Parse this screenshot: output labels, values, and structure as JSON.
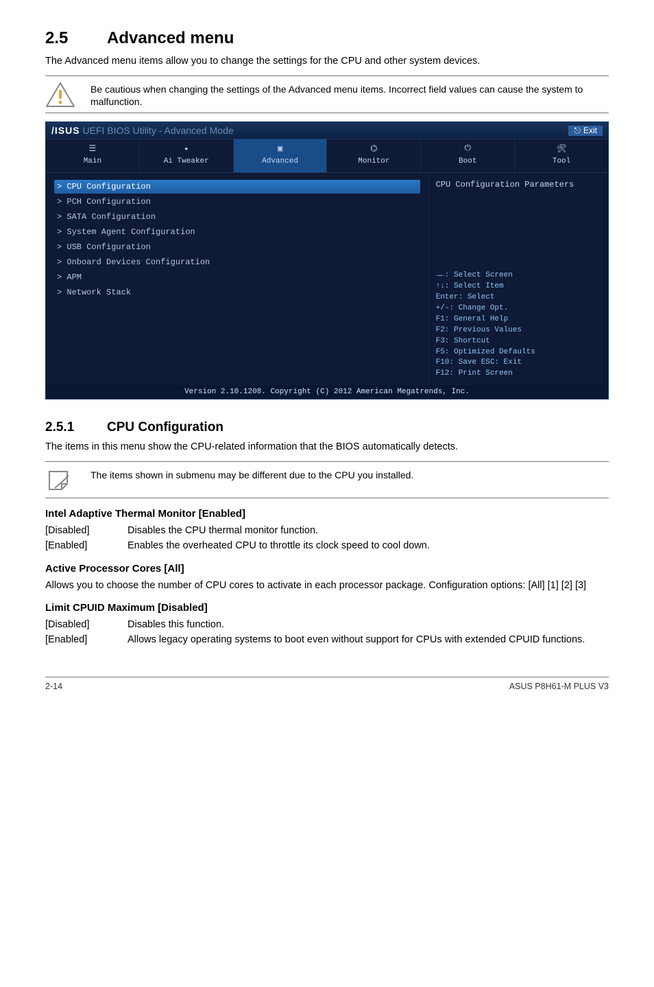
{
  "section": {
    "number": "2.5",
    "title": "Advanced menu",
    "intro": "The Advanced menu items allow you to change the settings for the CPU and other system devices."
  },
  "warning": "Be cautious when changing the settings of the Advanced menu items. Incorrect field values can cause the system to malfunction.",
  "bios": {
    "brand": "/ISUS",
    "title": "UEFI BIOS Utility - Advanced Mode",
    "exit": "Exit",
    "tabs": [
      {
        "label": "Main"
      },
      {
        "label": "Ai Tweaker"
      },
      {
        "label": "Advanced"
      },
      {
        "label": "Monitor"
      },
      {
        "label": "Boot"
      },
      {
        "label": "Tool"
      }
    ],
    "menu": [
      {
        "label": "CPU Configuration",
        "highlight": true,
        "marker": ">"
      },
      {
        "label": "PCH Configuration",
        "marker": ">"
      },
      {
        "label": "SATA Configuration",
        "marker": ">"
      },
      {
        "label": "System Agent Configuration",
        "marker": ">"
      },
      {
        "label": "USB Configuration",
        "marker": ">"
      },
      {
        "label": "Onboard Devices Configuration",
        "marker": ">"
      },
      {
        "label": "APM",
        "marker": ">"
      },
      {
        "label": "Network Stack",
        "marker": ">"
      }
    ],
    "help_title": "CPU Configuration Parameters",
    "help_keys": [
      "→←: Select Screen",
      "↑↓: Select Item",
      "Enter: Select",
      "+/-: Change Opt.",
      "F1: General Help",
      "F2: Previous Values",
      "F3: Shortcut",
      "F5: Optimized Defaults",
      "F10: Save  ESC: Exit",
      "F12: Print Screen"
    ],
    "footer": "Version 2.10.1208. Copyright (C) 2012 American Megatrends, Inc."
  },
  "subsection": {
    "number": "2.5.1",
    "title": "CPU Configuration",
    "intro": "The items in this menu show the CPU-related information that the BIOS automatically detects.",
    "note": "The items shown in submenu may be different due to the CPU you installed."
  },
  "settings": [
    {
      "title": "Intel Adaptive Thermal Monitor [Enabled]",
      "kv": [
        {
          "key": "[Disabled]",
          "val": "Disables the CPU thermal monitor function."
        },
        {
          "key": "[Enabled]",
          "val": "Enables the overheated CPU to throttle its clock speed to cool down."
        }
      ]
    },
    {
      "title": "Active Processor Cores [All]",
      "paras": [
        "Allows you to choose the number of CPU cores to activate in each processor package. Configuration options: [All] [1] [2] [3]"
      ]
    },
    {
      "title": "Limit CPUID Maximum [Disabled]",
      "kv": [
        {
          "key": "[Disabled]",
          "val": "Disables this function."
        },
        {
          "key": "[Enabled]",
          "val": "Allows legacy operating systems to boot even without support for CPUs with extended CPUID functions."
        }
      ]
    }
  ],
  "footer": {
    "page": "2-14",
    "product": "ASUS P8H61-M PLUS V3"
  }
}
